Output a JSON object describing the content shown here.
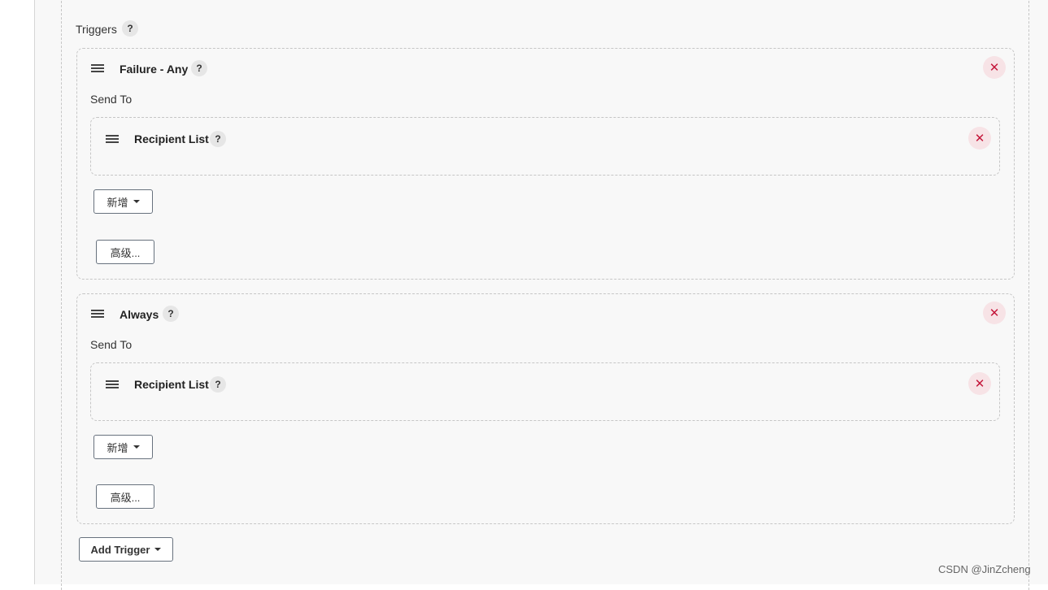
{
  "triggers": {
    "label": "Triggers",
    "help": "?",
    "items": [
      {
        "title": "Failure - Any",
        "help": "?",
        "close": "✕",
        "send_to": "Send To",
        "recipient": {
          "title": "Recipient List",
          "help": "?",
          "close": "✕"
        },
        "add_label": "新增",
        "advanced_label": "高级..."
      },
      {
        "title": "Always",
        "help": "?",
        "close": "✕",
        "send_to": "Send To",
        "recipient": {
          "title": "Recipient List",
          "help": "?",
          "close": "✕"
        },
        "add_label": "新增",
        "advanced_label": "高级..."
      }
    ],
    "add_trigger_label": "Add Trigger"
  },
  "watermark": "CSDN @JinZcheng"
}
